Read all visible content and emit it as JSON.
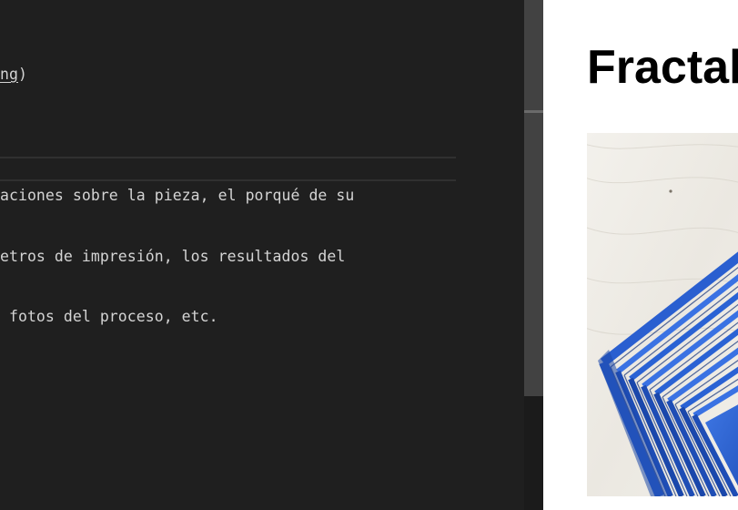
{
  "editor": {
    "lines": [
      {
        "pre": "",
        "underlined": "ng",
        "post": ")"
      },
      {
        "pre": "",
        "underlined": "",
        "post": ""
      },
      {
        "pre": "aciones sobre la pieza, el porqué de su",
        "underlined": "",
        "post": ""
      },
      {
        "pre": "etros de impresión, los resultados del",
        "underlined": "",
        "post": ""
      },
      {
        "pre": " fotos del proceso, etc.",
        "underlined": "",
        "post": ""
      }
    ],
    "colors": {
      "background": "#1f1f1f",
      "text": "#d4d4d4",
      "rule": "#303030"
    }
  },
  "scrollbar": {
    "colors": {
      "track": "#1b1b1b",
      "thumb": "#424242",
      "marker": "#6a6a6a"
    }
  },
  "preview": {
    "title": "Fractal",
    "image_icon": "blue-3d-printed-fractal-photo-icon",
    "colors": {
      "background": "#ffffff",
      "title": "#000000",
      "print_blue": "#2f63d6"
    }
  }
}
